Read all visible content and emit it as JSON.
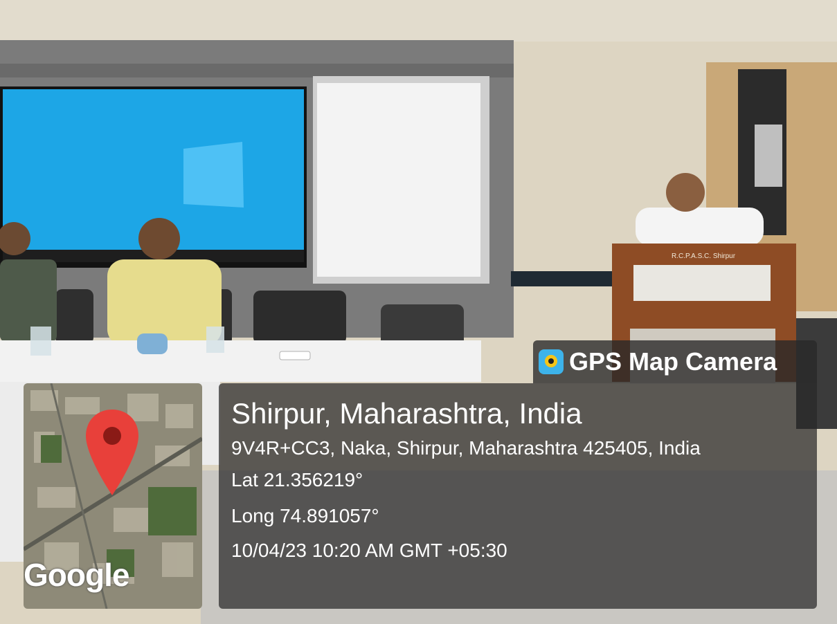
{
  "badge": {
    "app_name": "GPS Map Camera",
    "icon": "gps-map-camera-app-icon"
  },
  "location": {
    "title": "Shirpur, Maharashtra, India",
    "address": "9V4R+CC3, Naka, Shirpur, Maharashtra 425405, India",
    "lat": "Lat 21.356219°",
    "long": "Long 74.891057°",
    "datetime": "10/04/23 10:20 AM GMT +05:30"
  },
  "map": {
    "provider_logo": "Google",
    "pin": "map-pin-icon"
  },
  "scene": {
    "podium_plate": "R.C.P.A.S.C. Shirpur"
  }
}
